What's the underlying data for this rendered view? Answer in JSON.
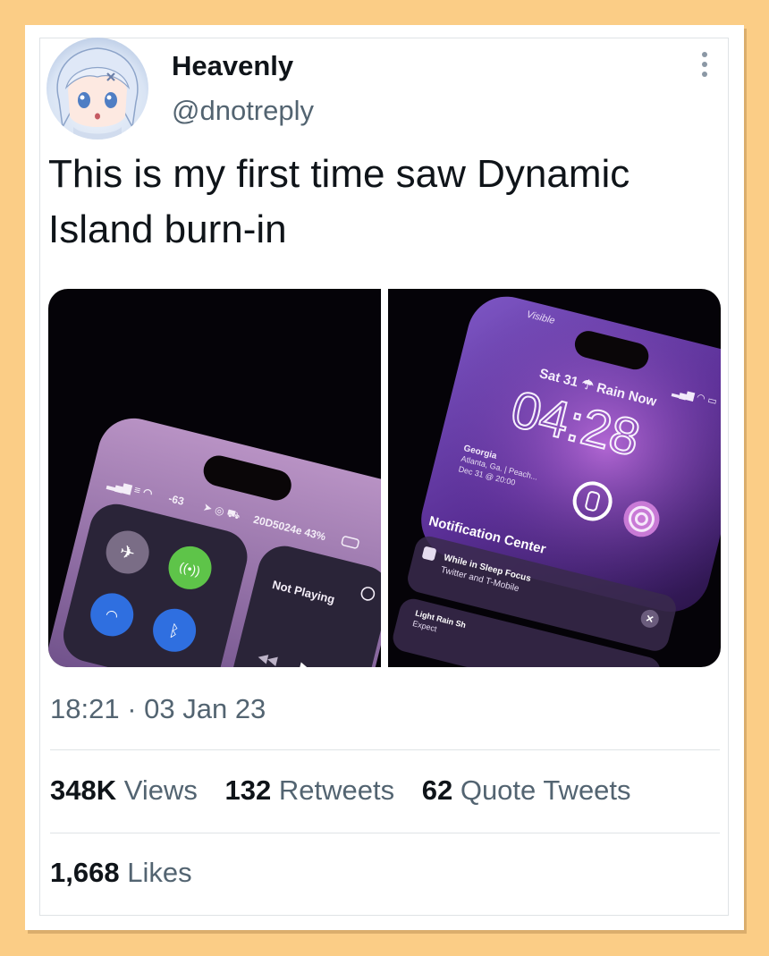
{
  "tweet": {
    "author_name": "Heavenly",
    "author_handle": "@dnotreply",
    "text": "This is my first time saw Dynamic Island burn-in",
    "timestamp": "18:21 · 03 Jan 23"
  },
  "stats": {
    "views_count": "348K",
    "views_label": "Views",
    "retweets_count": "132",
    "retweets_label": "Retweets",
    "quotes_count": "62",
    "quotes_label": "Quote Tweets",
    "likes_count": "1,668",
    "likes_label": "Likes"
  },
  "photo_left": {
    "status_signal": "-63",
    "status_right": "20D5024e 43%",
    "media_label": "Not Playing",
    "icons": [
      "airplane-icon",
      "antenna-icon",
      "wifi-icon",
      "bluetooth-icon",
      "rewind-icon",
      "play-icon",
      "airplay-icon"
    ]
  },
  "photo_right": {
    "visible_label": "Visible",
    "date_weather": "Sat 31 ☂ Rain Now",
    "clock": "04:28",
    "weather_location": "Georgia",
    "weather_line1": "Atlanta, Ga. | Peach...",
    "weather_line2": "Dec 31 @ 20:00",
    "notification_header": "Notification Center",
    "notif_title": "While in Sleep Focus",
    "notif_body": "Twitter and T-Mobile",
    "notif2_title": "Light Rain Sh",
    "notif2_body": "Expect"
  },
  "colors": {
    "page_background": "#fbcd86",
    "text_primary": "#0f1419",
    "text_secondary": "#536471",
    "phone_purple": "#7b4fa3",
    "green_toggle": "#5ec449",
    "blue_toggle": "#2f6fe0"
  }
}
